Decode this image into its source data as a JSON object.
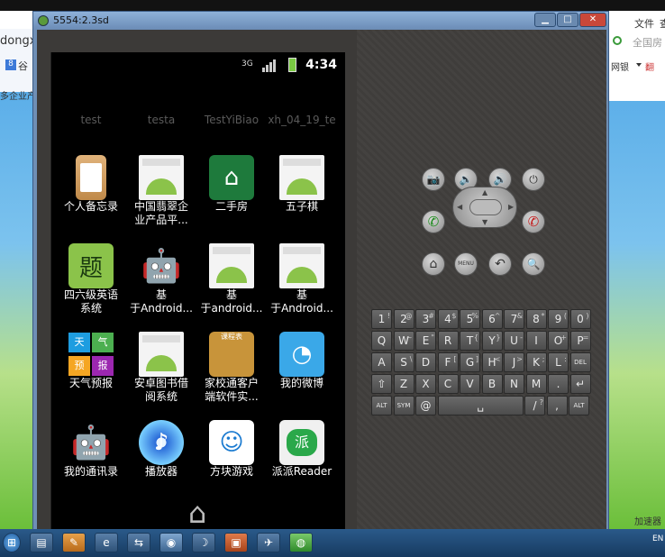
{
  "emulator": {
    "title": "5554:2.3sd"
  },
  "background": {
    "left_window": {
      "url_fragment": "dongx",
      "bookmark": "谷",
      "bar_text": "多企业产"
    },
    "right_window": {
      "menu": "文件",
      "menu2": "查",
      "search_placeholder": "全国房",
      "tab1": "网银",
      "tab2": "翻",
      "status": "加速器"
    }
  },
  "statusbar": {
    "time": "4:34",
    "signal_label": "3G"
  },
  "launcher_tabs": [
    "test",
    "testa",
    "TestYiBiao",
    "xh_04_19_te"
  ],
  "apps": [
    {
      "label": "个人备忘录",
      "icon": "clipboard-icon"
    },
    {
      "label": "中国翡翠企\n业产品平...",
      "icon": "android-doc-icon"
    },
    {
      "label": "二手房",
      "icon": "house-icon"
    },
    {
      "label": "五子棋",
      "icon": "android-doc-icon"
    },
    {
      "label": "四六级英语\n系统",
      "icon": "ti-icon"
    },
    {
      "label": "基\n于Android...",
      "icon": "android-robot-icon"
    },
    {
      "label": "基\n于android...",
      "icon": "android-doc-icon"
    },
    {
      "label": "基\n于Android...",
      "icon": "android-doc-icon"
    },
    {
      "label": "天气预报",
      "icon": "weather-tiles-icon"
    },
    {
      "label": "安卓图书借\n阅系统",
      "icon": "android-doc-icon"
    },
    {
      "label": "家校通客户\n端软件实...",
      "icon": "schedule-icon"
    },
    {
      "label": "我的微博",
      "icon": "weibo-icon"
    },
    {
      "label": "我的通讯录",
      "icon": "android-robot-icon"
    },
    {
      "label": "播放器",
      "icon": "music-cd-icon"
    },
    {
      "label": "方块游戏",
      "icon": "doraemon-icon"
    },
    {
      "label": "派派Reader",
      "icon": "reader-icon"
    }
  ],
  "weather_tiles": [
    "天",
    "气",
    "预",
    "报"
  ],
  "ti_char": "题",
  "schedule_text": "课程表",
  "reader_char": "派",
  "hw_buttons": {
    "camera": "📷",
    "vol_down": "🔉",
    "vol_up": "🔊",
    "power": "⏻",
    "menu": "MENU",
    "search": "🔍",
    "back": "↶",
    "home": "⌂"
  },
  "keyboard": {
    "row1": [
      {
        "k": "1",
        "s": "!"
      },
      {
        "k": "2",
        "s": "@"
      },
      {
        "k": "3",
        "s": "#"
      },
      {
        "k": "4",
        "s": "$"
      },
      {
        "k": "5",
        "s": "%"
      },
      {
        "k": "6",
        "s": "^"
      },
      {
        "k": "7",
        "s": "&"
      },
      {
        "k": "8",
        "s": "*"
      },
      {
        "k": "9",
        "s": "("
      },
      {
        "k": "0",
        "s": ")"
      }
    ],
    "row2": [
      {
        "k": "Q",
        "s": ""
      },
      {
        "k": "W",
        "s": "~"
      },
      {
        "k": "E",
        "s": "\""
      },
      {
        "k": "R",
        "s": ""
      },
      {
        "k": "T",
        "s": "{"
      },
      {
        "k": "Y",
        "s": "}"
      },
      {
        "k": "U",
        "s": "-"
      },
      {
        "k": "I",
        "s": ""
      },
      {
        "k": "O",
        "s": "+"
      },
      {
        "k": "P",
        "s": "="
      }
    ],
    "row3": [
      {
        "k": "A",
        "s": ""
      },
      {
        "k": "S",
        "s": "\\"
      },
      {
        "k": "D",
        "s": ""
      },
      {
        "k": "F",
        "s": "["
      },
      {
        "k": "G",
        "s": "]"
      },
      {
        "k": "H",
        "s": "<"
      },
      {
        "k": "J",
        "s": ">"
      },
      {
        "k": "K",
        "s": ";"
      },
      {
        "k": "L",
        "s": ":"
      },
      {
        "k": "DEL",
        "s": ""
      }
    ],
    "row4": [
      {
        "k": "⇧",
        "s": ""
      },
      {
        "k": "Z",
        "s": ""
      },
      {
        "k": "X",
        "s": ""
      },
      {
        "k": "C",
        "s": ""
      },
      {
        "k": "V",
        "s": ""
      },
      {
        "k": "B",
        "s": ""
      },
      {
        "k": "N",
        "s": ""
      },
      {
        "k": "M",
        "s": ""
      },
      {
        "k": ".",
        "s": ""
      },
      {
        "k": "↵",
        "s": ""
      }
    ],
    "row5": [
      {
        "k": "ALT",
        "s": ""
      },
      {
        "k": "SYM",
        "s": ""
      },
      {
        "k": "@",
        "s": ""
      },
      {
        "k": "␣",
        "s": ""
      },
      {
        "k": "/",
        "s": "?"
      },
      {
        "k": ",",
        "s": ""
      },
      {
        "k": "ALT",
        "s": ""
      }
    ]
  },
  "taskbar": {
    "lang": "EN"
  }
}
